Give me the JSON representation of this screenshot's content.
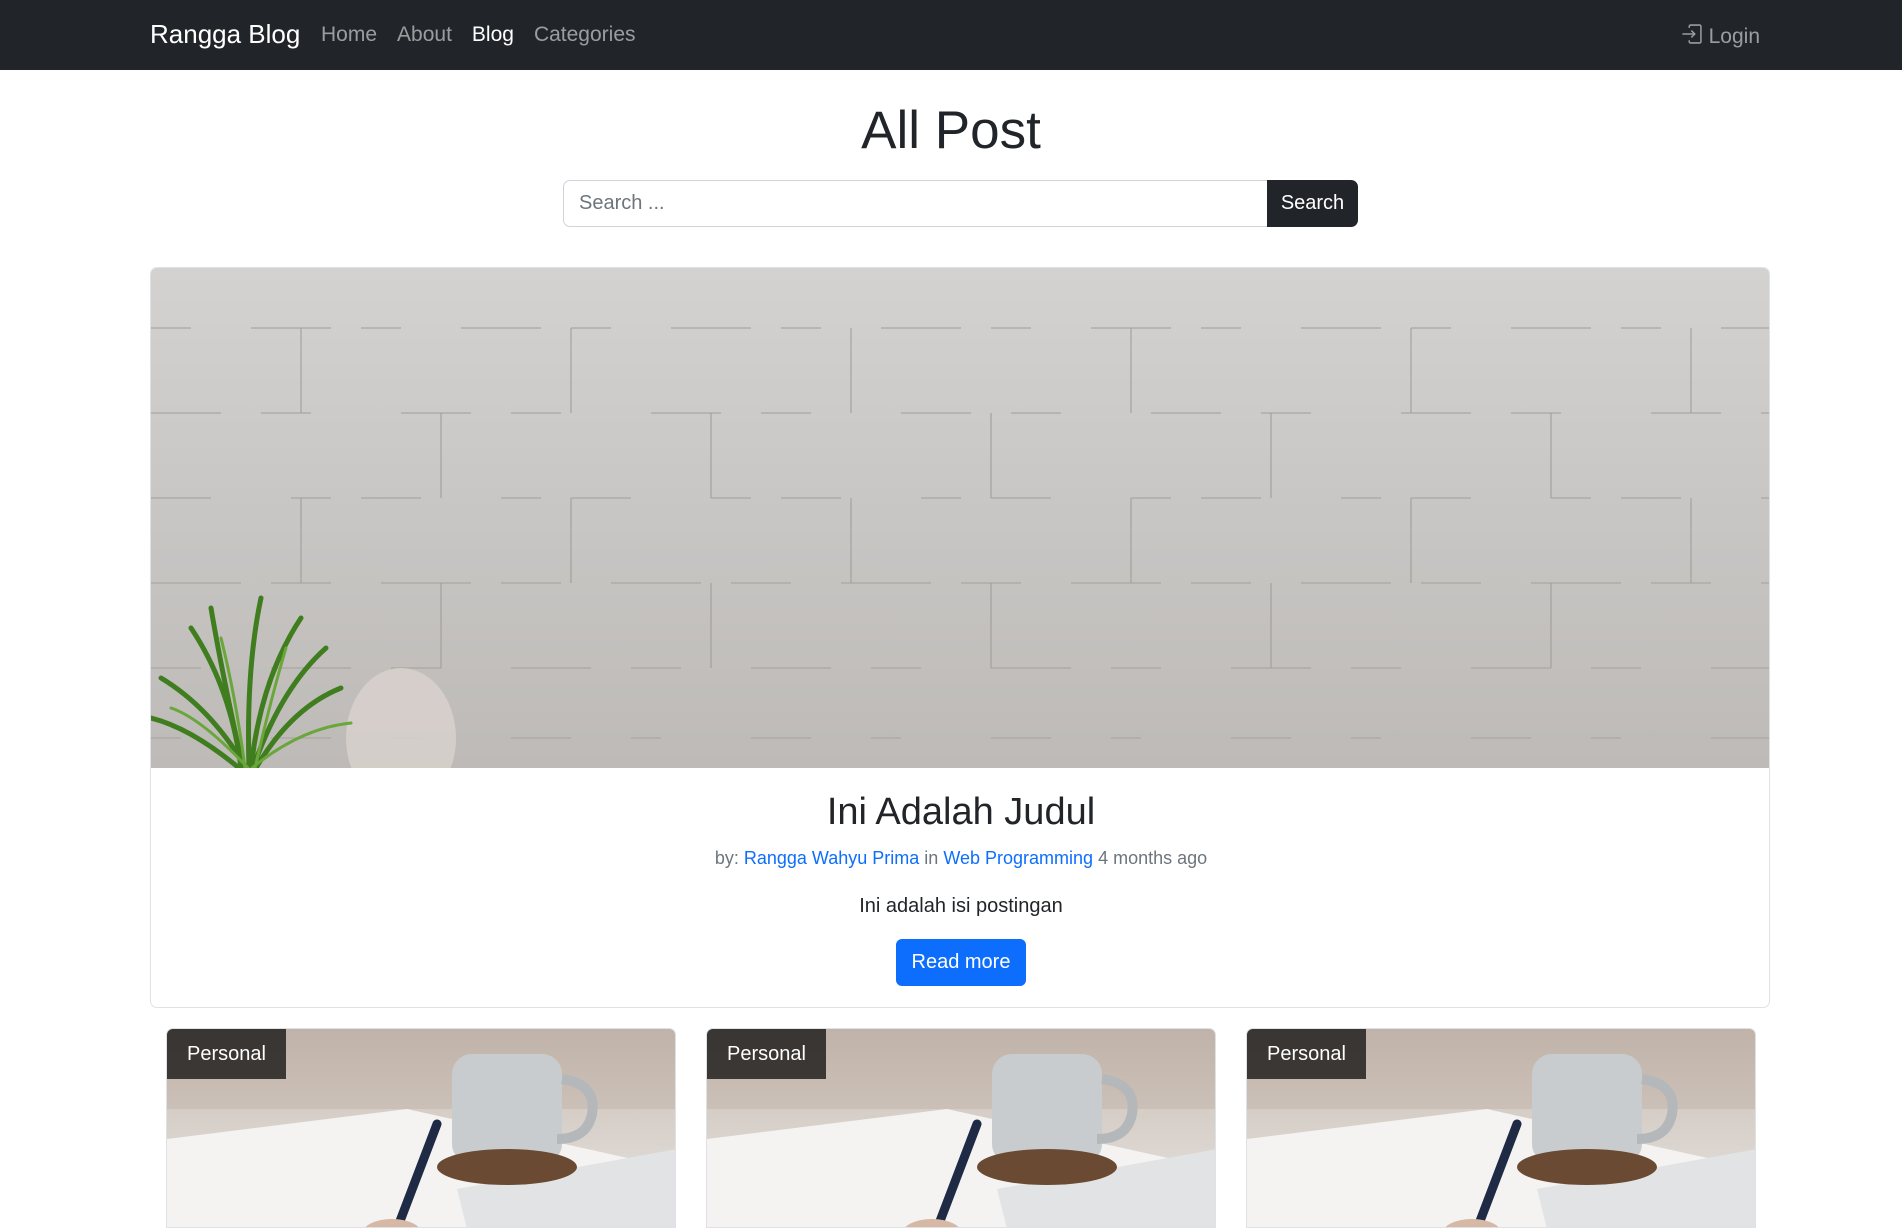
{
  "navbar": {
    "brand": "Rangga Blog",
    "links": [
      {
        "label": "Home",
        "active": false
      },
      {
        "label": "About",
        "active": false
      },
      {
        "label": "Blog",
        "active": true
      },
      {
        "label": "Categories",
        "active": false
      }
    ],
    "login_label": "Login",
    "login_icon": "box-arrow-in-right-icon"
  },
  "page": {
    "title": "All Post"
  },
  "search": {
    "placeholder": "Search ...",
    "button_label": "Search"
  },
  "featured": {
    "title": "Ini Adalah Judul",
    "meta_by": "by:",
    "author": "Rangga Wahyu Prima",
    "meta_in": "in",
    "category": "Web Programming",
    "time": "4 months ago",
    "excerpt": "Ini adalah isi postingan",
    "read_more": "Read more"
  },
  "posts": [
    {
      "category": "Personal"
    },
    {
      "category": "Personal"
    },
    {
      "category": "Personal"
    }
  ],
  "colors": {
    "navbar_bg": "#212529",
    "primary": "#0d6efd",
    "link": "#0d6efd",
    "muted": "#6c757d"
  }
}
